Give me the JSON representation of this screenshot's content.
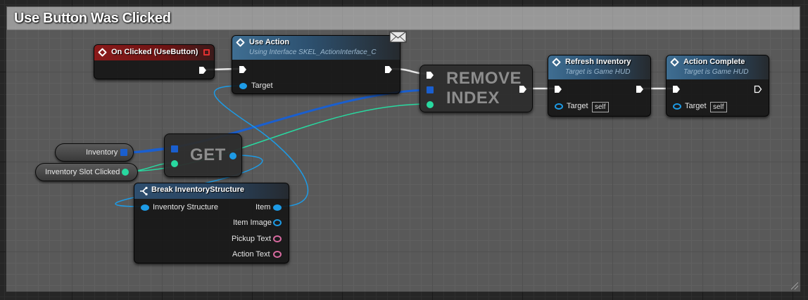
{
  "comment": {
    "title": "Use Button Was Clicked"
  },
  "nodes": {
    "on_clicked": {
      "title": "On Clicked (UseButton)"
    },
    "use_action": {
      "title": "Use Action",
      "subtitle": "Using Interface SKEL_ActionInterface_C",
      "target": "Target"
    },
    "remove_index": {
      "title_line1": "REMOVE",
      "title_line2": "INDEX"
    },
    "refresh_inventory": {
      "title": "Refresh Inventory",
      "subtitle": "Target is Game HUD",
      "target": "Target",
      "self": "self"
    },
    "action_complete": {
      "title": "Action Complete",
      "subtitle": "Target is Game HUD",
      "target": "Target",
      "self": "self"
    },
    "inventory_var": {
      "label": "Inventory"
    },
    "slot_var": {
      "label": "Inventory Slot Clicked"
    },
    "get": {
      "title": "GET"
    },
    "break_struct": {
      "title": "Break InventoryStructure",
      "input": "Inventory Structure",
      "outputs": [
        "Item",
        "Item Image",
        "Pickup Text",
        "Action Text"
      ]
    }
  },
  "colors": {
    "exec": "#ffffff",
    "object": "#1d9be6",
    "integer": "#28d9a0",
    "array": "#1a5fcf",
    "text": "#d86aa0",
    "event_header": "#8a1a1a",
    "function_header": "#3f6e92"
  },
  "icons": [
    "function-icon",
    "event-icon",
    "message-icon",
    "break-struct-icon"
  ]
}
